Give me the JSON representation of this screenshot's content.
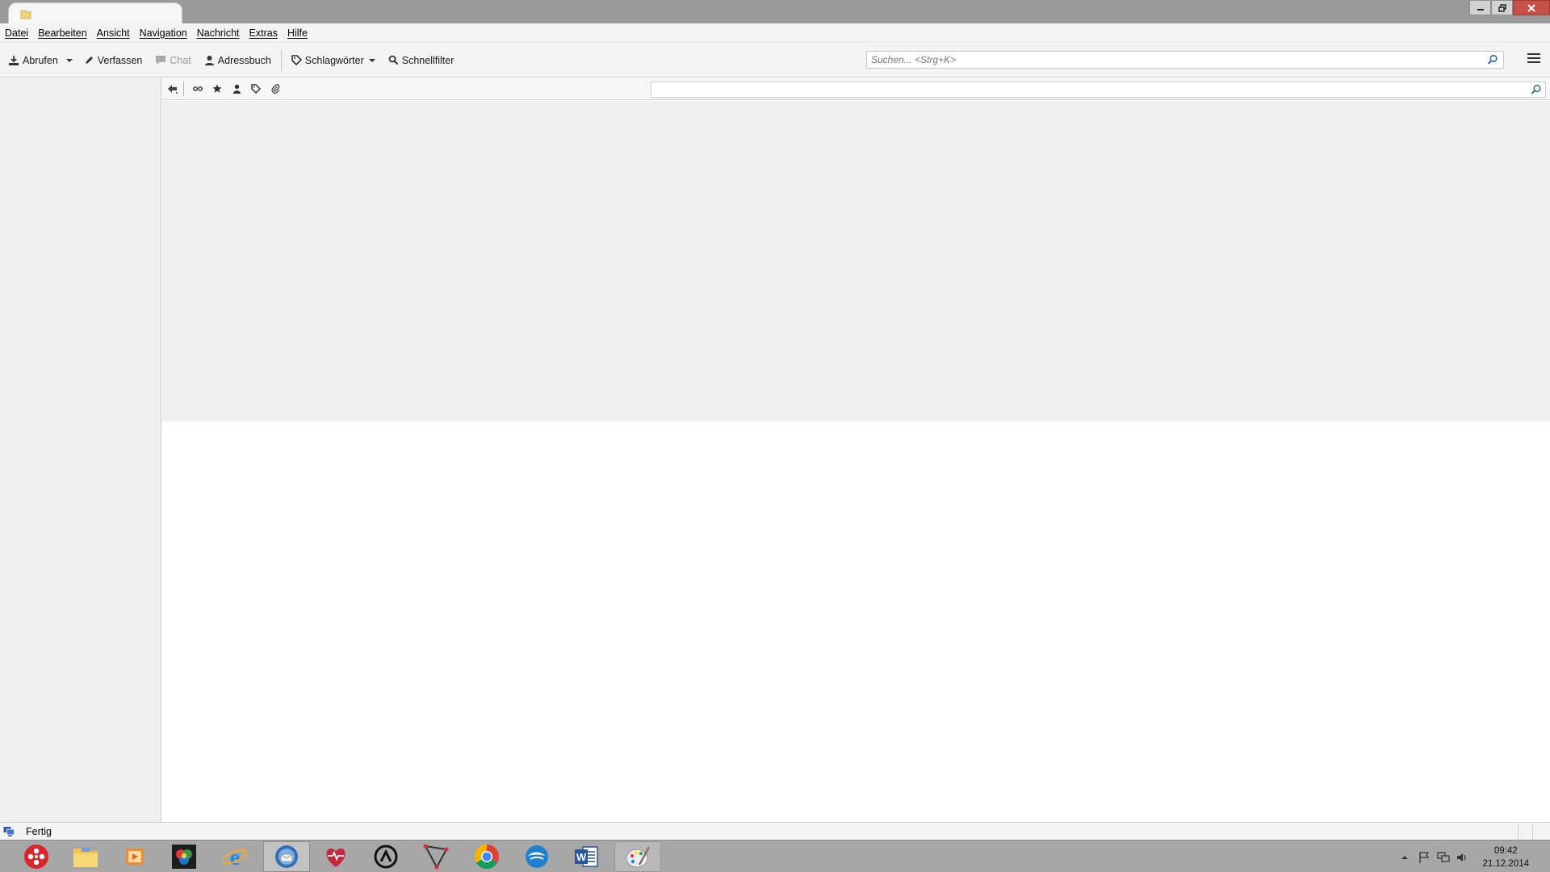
{
  "window": {
    "tab_icon": "folder-icon",
    "controls": [
      "minimize-icon",
      "restore-icon",
      "close-icon"
    ]
  },
  "menubar": {
    "items": [
      {
        "label": "Datei"
      },
      {
        "label": "Bearbeiten"
      },
      {
        "label": "Ansicht"
      },
      {
        "label": "Navigation"
      },
      {
        "label": "Nachricht"
      },
      {
        "label": "Extras"
      },
      {
        "label": "Hilfe"
      }
    ]
  },
  "toolbar": {
    "get_messages": "Abrufen",
    "compose": "Verfassen",
    "chat": "Chat",
    "address_book": "Adressbuch",
    "tags": "Schlagwörter",
    "quick_filter": "Schnellfilter",
    "search_placeholder": "Suchen... <Strg+K>"
  },
  "filterbar": {
    "icons": [
      "keep-filter-icon",
      "unread-icon",
      "starred-icon",
      "contact-icon",
      "tag-icon",
      "attachment-icon"
    ],
    "filter_value": ""
  },
  "statusbar": {
    "text": "Fertig"
  },
  "taskbar": {
    "apps": [
      {
        "name": "start-app-icon",
        "color": "#d9262b"
      },
      {
        "name": "file-explorer-icon",
        "color": "#f2c34a"
      },
      {
        "name": "media-player-icon",
        "color": "#f08c2a"
      },
      {
        "name": "photo-app-icon",
        "color": "#222222"
      },
      {
        "name": "internet-explorer-icon",
        "color": "#1e88e5"
      },
      {
        "name": "thunderbird-icon",
        "color": "#2f6db5"
      },
      {
        "name": "health-app-icon",
        "color": "#c6283b"
      },
      {
        "name": "avast-icon",
        "color": "#222222"
      },
      {
        "name": "tool-app-icon",
        "color": "#444444"
      },
      {
        "name": "chrome-icon",
        "color": "#4caf50"
      },
      {
        "name": "bird-app-icon",
        "color": "#1f7fd1"
      },
      {
        "name": "word-icon",
        "color": "#2b579a"
      },
      {
        "name": "paint-icon",
        "color": "#9aa6b8"
      }
    ],
    "clock_time": "09:42",
    "clock_date": "21.12.2014",
    "tray_icons": [
      "show-hidden-icon",
      "flag-icon",
      "network-icon",
      "volume-icon"
    ]
  }
}
